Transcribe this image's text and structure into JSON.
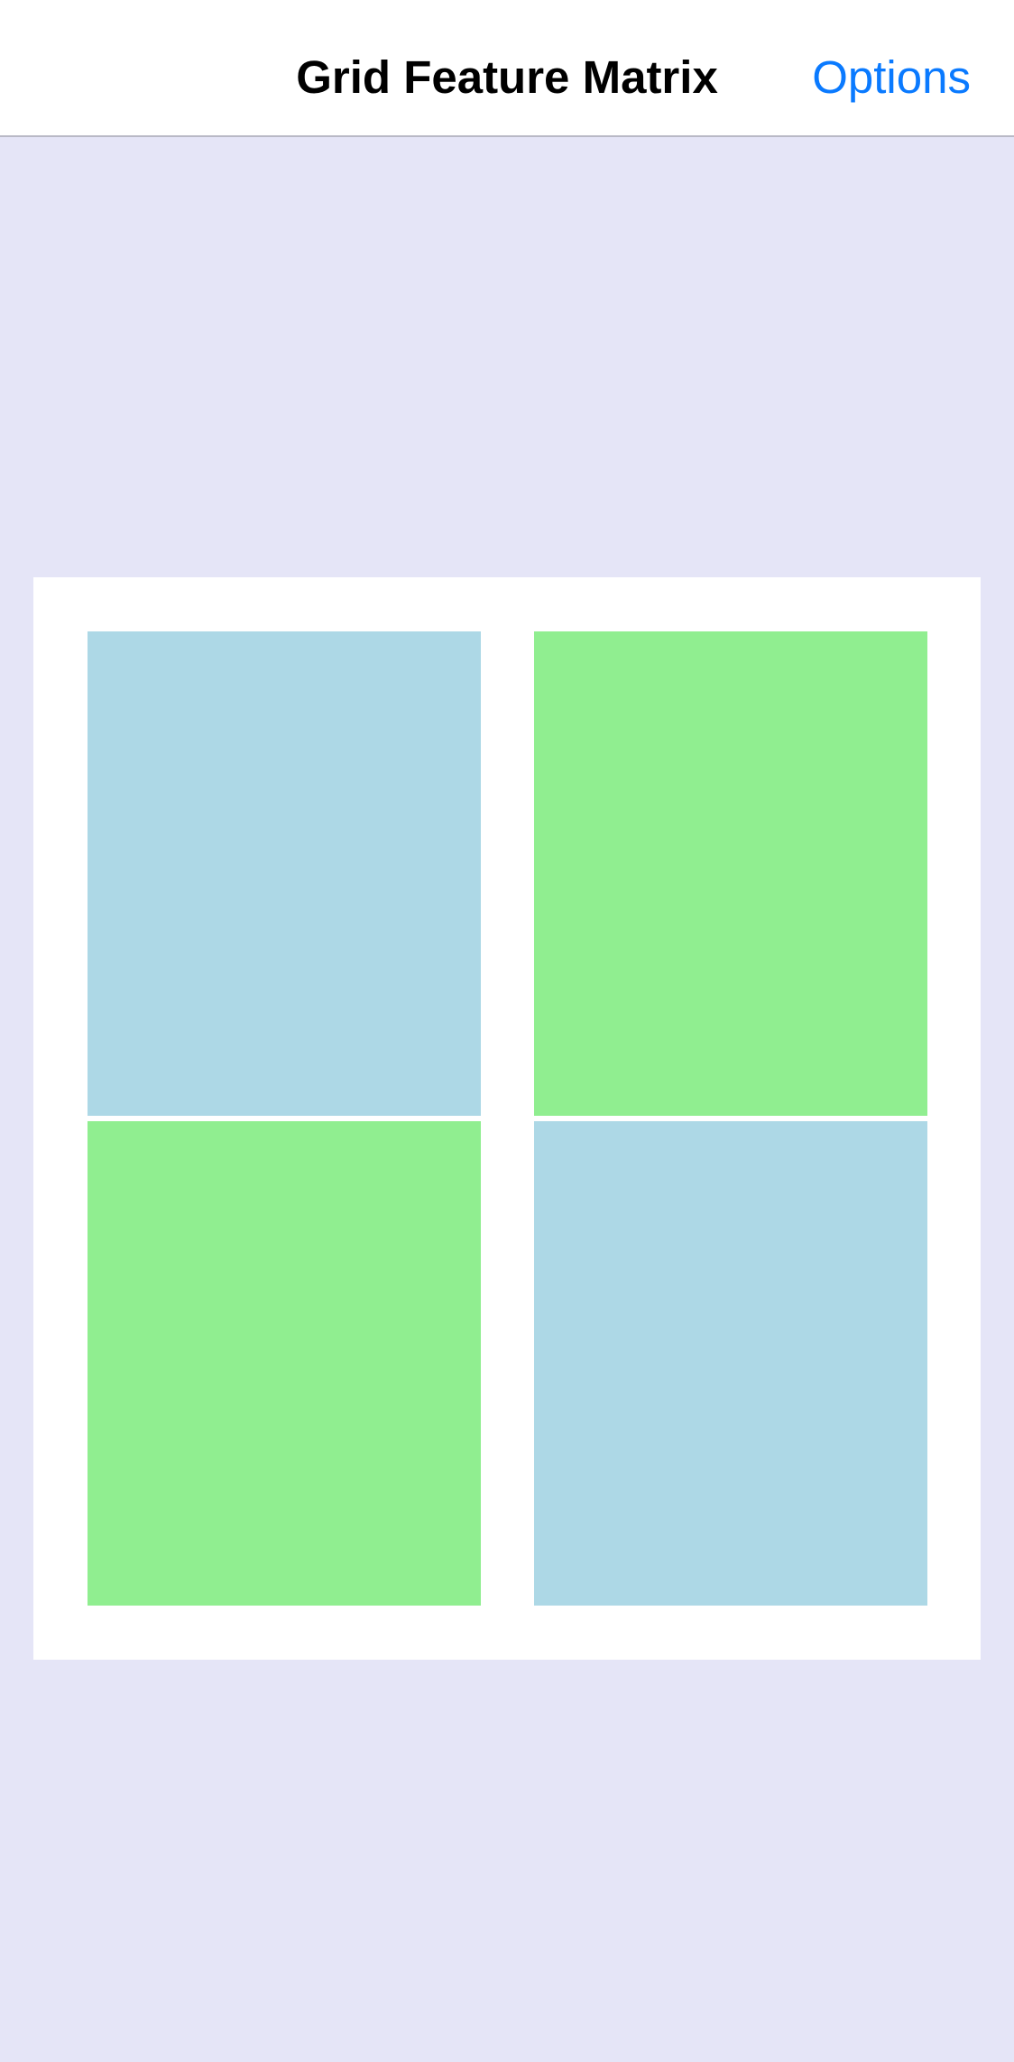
{
  "nav": {
    "title": "Grid Feature Matrix",
    "options_label": "Options"
  },
  "colors": {
    "background": "#e5e5f7",
    "accent": "#0a7aff",
    "cell_blue": "#add8e6",
    "cell_green": "#90ee90"
  },
  "grid": {
    "rows": 2,
    "columns": 2,
    "cells": [
      {
        "color": "light-blue"
      },
      {
        "color": "light-green"
      },
      {
        "color": "light-green"
      },
      {
        "color": "light-blue"
      }
    ]
  }
}
